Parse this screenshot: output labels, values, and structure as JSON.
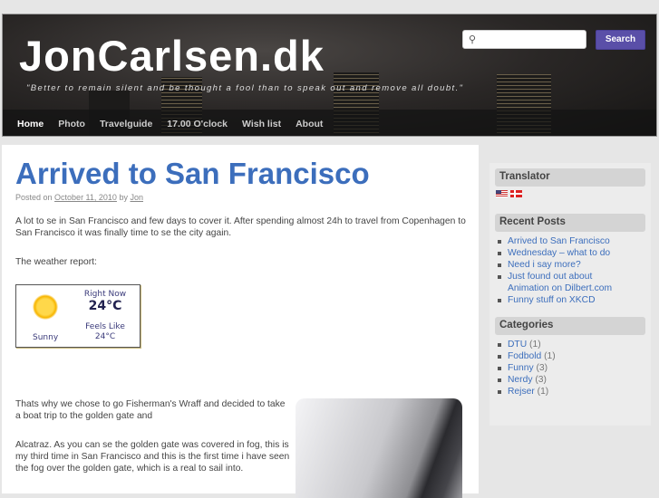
{
  "header": {
    "site_title": "JonCarlsen.dk",
    "tagline": "\"Better to remain silent and be thought a fool than to speak out and remove all doubt.\"",
    "search_placeholder": "",
    "search_button": "Search"
  },
  "nav": [
    "Home",
    "Photo",
    "Travelguide",
    "17.00 O'clock",
    "Wish list",
    "About"
  ],
  "post": {
    "title": "Arrived to San Francisco",
    "posted_on": "Posted on",
    "date": "October 11, 2010",
    "by": "by",
    "author": "Jon",
    "p1": "A lot to se in San Francisco and few days to cover it. After spending almost 24h to travel from Copenhagen to San Francisco it was finally time to se the city again.",
    "p2": "The weather report:",
    "p3": "Thats why we chose to go Fisherman's Wraff and decided to take a boat trip to the golden gate and",
    "p4": "Alcatraz. As you can se the golden gate was covered in fog, this is my third time in San Francisco and this is the first time i have seen the fog over the golden gate, which is a real to sail into."
  },
  "weather": {
    "now_label": "Right Now",
    "temp": "24°C",
    "feels_label": "Feels Like",
    "feels": "24°C",
    "condition": "Sunny"
  },
  "sidebar": {
    "translator_title": "Translator",
    "recent_title": "Recent Posts",
    "recent": [
      "Arrived to San Francisco",
      "Wednesday – what to do",
      "Need i say more?",
      "Just found out about Animation on Dilbert.com",
      "Funny stuff on XKCD"
    ],
    "categories_title": "Categories",
    "categories": [
      {
        "name": "DTU",
        "count": "(1)"
      },
      {
        "name": "Fodbold",
        "count": "(1)"
      },
      {
        "name": "Funny",
        "count": "(3)"
      },
      {
        "name": "Nerdy",
        "count": "(3)"
      },
      {
        "name": "Rejser",
        "count": "(1)"
      }
    ]
  }
}
